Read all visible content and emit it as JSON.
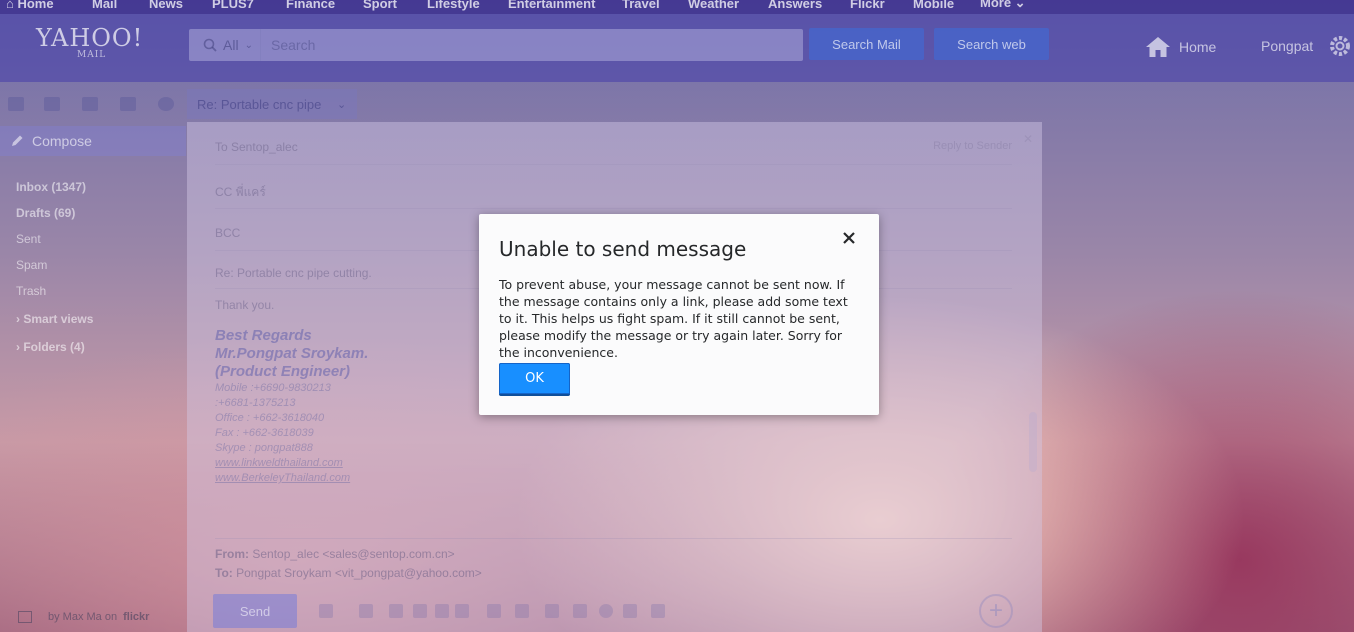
{
  "top_nav": [
    "Home",
    "Mail",
    "News",
    "PLUS7",
    "Finance",
    "Sport",
    "Lifestyle",
    "Entertainment",
    "Travel",
    "Weather",
    "Answers",
    "Flickr",
    "Mobile",
    "More"
  ],
  "header": {
    "logo": "YAHOO!",
    "logo_sub": "MAIL",
    "search_scope": "All",
    "search_placeholder": "Search",
    "search_mail": "Search Mail",
    "search_web": "Search web",
    "home": "Home",
    "user": "Pongpat"
  },
  "toolbar": {
    "subject_tab": "Re: Portable cnc pipe"
  },
  "sidebar": {
    "compose": "Compose",
    "folders": [
      "Inbox (1347)",
      "Drafts (69)",
      "Sent",
      "Spam",
      "Trash",
      "Smart views",
      "Folders (4)"
    ],
    "credit_prefix": "by Max Ma on",
    "credit_brand": "flickr"
  },
  "compose": {
    "to": "To  Sentop_alec",
    "reply_to_sender": "Reply to Sender",
    "cc": "CC  พี่แคร์",
    "bcc": "BCC",
    "subject": "Re:  Portable cnc pipe cutting.",
    "body_first": "Thank you.",
    "sig_lines": [
      "Best Regards",
      "Mr.Pongpat Sroykam.",
      "(Product Engineer)"
    ],
    "sig_details": [
      "Mobile  :+6690-9830213",
      "           :+6681-1375213",
      "Office   : +662-3618040",
      "Fax      : +662-3618039",
      "Skype  : pongpat888"
    ],
    "sig_links": [
      "www.linkweldthailand.com",
      "www.BerkeleyThailand.com"
    ],
    "quote_from_label": "From:",
    "quote_from": "Sentop_alec <sales@sentop.com.cn>",
    "quote_to_label": "To:",
    "quote_to": "Pongpat Sroykam <vit_pongpat@yahoo.com>",
    "send": "Send"
  },
  "modal": {
    "title": "Unable to send message",
    "body": "To prevent abuse, your message cannot be sent now. If the message contains only a link, please add some text to it. This helps us fight spam. If it still cannot be sent, please modify the message or try again later. Sorry for the inconvenience.",
    "ok": "OK"
  },
  "colors": {
    "primary_button": "#188fff",
    "modal_bg": "#fbfbfc",
    "text": "#26282a"
  }
}
